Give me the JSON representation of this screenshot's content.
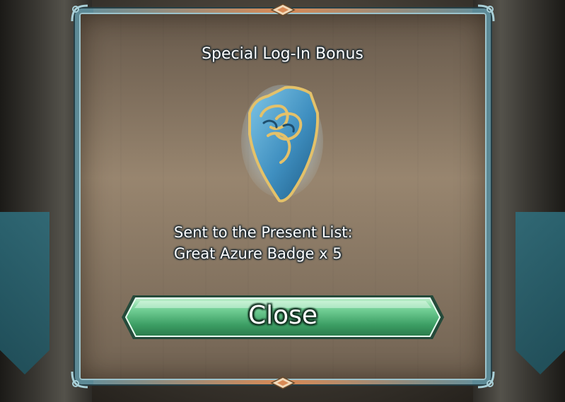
{
  "dialog": {
    "title": "Special Log-In Bonus",
    "reward_icon": "great-azure-badge-icon",
    "message_line1": "Sent to the Present List:",
    "message_line2": "Great Azure Badge x 5",
    "close_label": "Close"
  },
  "colors": {
    "frame": "#5d8a96",
    "frame_accent": "#d98a55",
    "button_green": "#5fbf8a",
    "badge_blue": "#3f8fc0",
    "badge_gold": "#e3c16a"
  }
}
